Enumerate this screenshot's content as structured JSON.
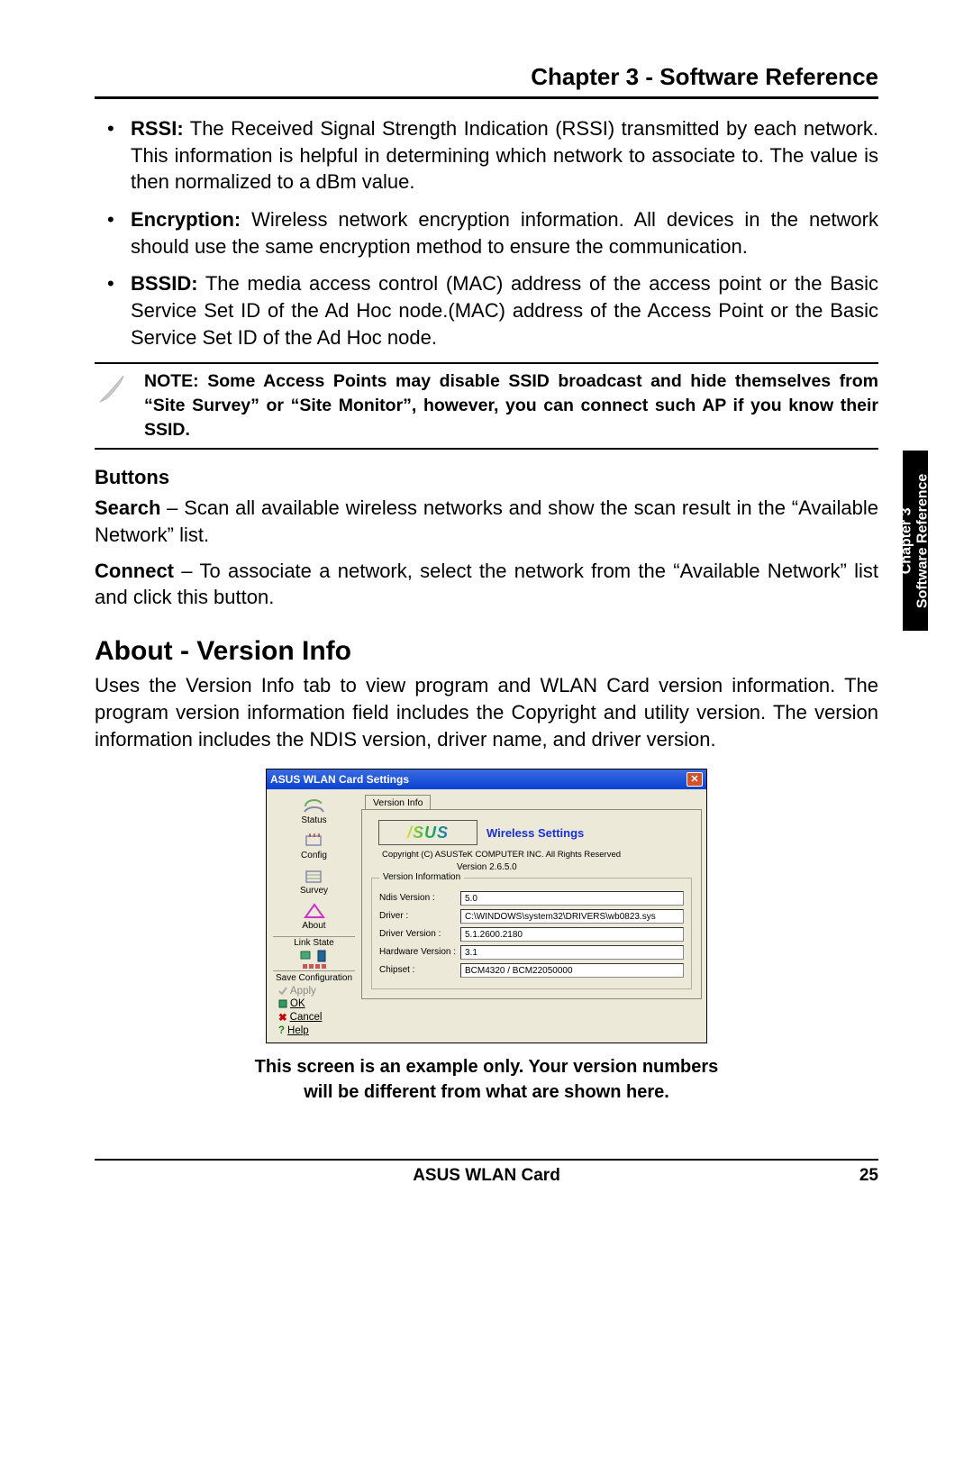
{
  "header": {
    "chapter_title": "Chapter 3 - Software Reference"
  },
  "side_tab": {
    "line1": "Chapter 3",
    "line2": "Software Reference"
  },
  "bullets": [
    {
      "term": "RSSI:",
      "text": " The Received Signal Strength Indication (RSSI) transmitted by each network. This information is helpful in determining which network to associate to. The value is then normalized to a dBm value."
    },
    {
      "term": "Encryption:",
      "text": " Wireless network encryption information. All devices in the network should use the same encryption method to ensure the communication."
    },
    {
      "term": "BSSID:",
      "text": " The media access control (MAC) address of the access point or the Basic Service Set ID of the Ad Hoc node.(MAC) address of the Access Point or the Basic Service Set ID of the Ad Hoc node."
    }
  ],
  "note": "NOTE: Some Access Points may disable SSID broadcast and hide themselves from “Site Survey” or “Site Monitor”, however, you can connect such AP if you know their SSID.",
  "subhead_buttons": "Buttons",
  "search_para": {
    "term": "Search",
    "sep": " – ",
    "text": "Scan all available wireless networks and show the scan result in the “Available Network” list."
  },
  "connect_para": {
    "term": "Connect",
    "sep": " – ",
    "text": "To associate a network, select the network from the “Available Network” list and click this button."
  },
  "about_heading": "About - Version Info",
  "about_para": "Uses the Version Info tab to view program and WLAN Card version information. The program version information field includes the Copyright and utility version. The version information includes the NDIS version, driver name, and driver version.",
  "dialog": {
    "title": "ASUS WLAN Card Settings",
    "tab": "Version Info",
    "logo_text": "/SUS",
    "wireless_settings": "Wireless Settings",
    "copyright": "Copyright (C) ASUSTeK COMPUTER INC. All Rights Reserved",
    "version_top": "Version 2.6.5.0",
    "fs_legend": "Version Information",
    "fields": {
      "ndis": {
        "label": "Ndis Version :",
        "value": "5.0"
      },
      "driver": {
        "label": "Driver :",
        "value": "C:\\WINDOWS\\system32\\DRIVERS\\wb0823.sys"
      },
      "drv_ver": {
        "label": "Driver Version :",
        "value": "5.1.2600.2180"
      },
      "hw_ver": {
        "label": "Hardware Version :",
        "value": "3.1"
      },
      "chipset": {
        "label": "Chipset :",
        "value": "BCM4320 / BCM22050000"
      }
    },
    "sidebar": {
      "status": "Status",
      "config": "Config",
      "survey": "Survey",
      "about": "About",
      "link_state": "Link State",
      "save_conf": "Save Configuration",
      "apply": "Apply",
      "ok": "OK",
      "cancel": "Cancel",
      "help": "Help"
    }
  },
  "caption_line1": "This screen is an example only. Your version numbers",
  "caption_line2": "will be different from what are shown here.",
  "footer": {
    "product": "ASUS WLAN Card",
    "page": "25"
  }
}
